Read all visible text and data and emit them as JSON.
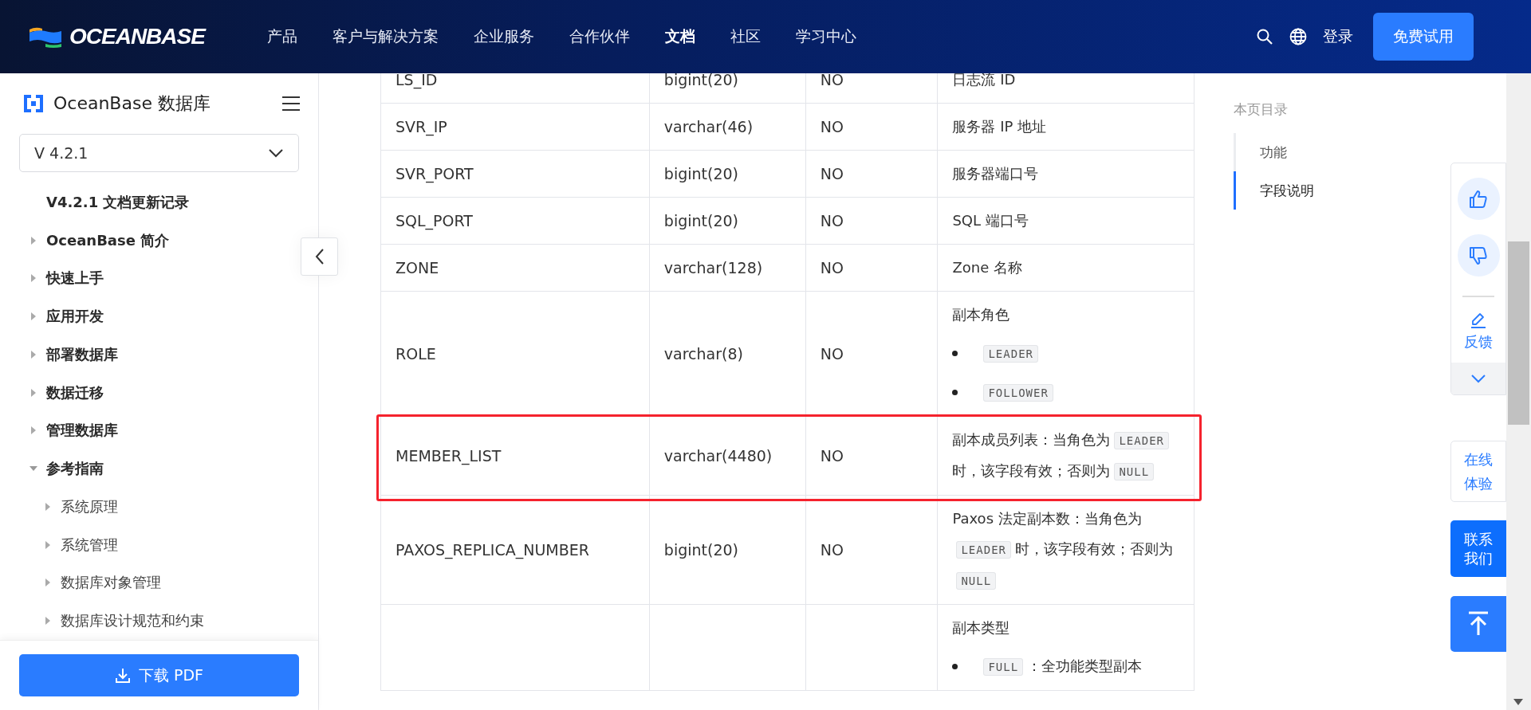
{
  "header": {
    "logo": "OCEANBASE",
    "nav": [
      {
        "label": "产品",
        "selected": false
      },
      {
        "label": "客户与解决方案",
        "selected": false
      },
      {
        "label": "企业服务",
        "selected": false
      },
      {
        "label": "合作伙伴",
        "selected": false
      },
      {
        "label": "文档",
        "selected": true
      },
      {
        "label": "社区",
        "selected": false
      },
      {
        "label": "学习中心",
        "selected": false
      }
    ],
    "login": "登录",
    "cta": "免费试用"
  },
  "sidebar": {
    "title": "OceanBase 数据库",
    "version": "V 4.2.1",
    "items": [
      {
        "label": "V4.2.1 文档更新记录"
      },
      {
        "label": "OceanBase 简介",
        "expanded": false
      },
      {
        "label": "快速上手",
        "expanded": false
      },
      {
        "label": "应用开发",
        "expanded": false
      },
      {
        "label": "部署数据库",
        "expanded": false
      },
      {
        "label": "数据迁移",
        "expanded": false
      },
      {
        "label": "管理数据库",
        "expanded": false
      },
      {
        "label": "参考指南",
        "expanded": true,
        "children": [
          {
            "label": "系统原理",
            "expanded": false
          },
          {
            "label": "系统管理",
            "expanded": false
          },
          {
            "label": "数据库对象管理",
            "expanded": false
          },
          {
            "label": "数据库设计规范和约束",
            "expanded": false
          }
        ]
      }
    ],
    "download": "下载 PDF"
  },
  "table": {
    "rows": [
      {
        "name": "LS_ID",
        "type": "bigint(20)",
        "nullable": "NO",
        "highlighted": false,
        "description": [
          {
            "kind": "para",
            "parts": [
              {
                "kind": "text",
                "text": "日志流 ID"
              }
            ]
          }
        ]
      },
      {
        "name": "SVR_IP",
        "type": "varchar(46)",
        "nullable": "NO",
        "highlighted": false,
        "description": [
          {
            "kind": "para",
            "parts": [
              {
                "kind": "text",
                "text": "服务器 IP 地址"
              }
            ]
          }
        ]
      },
      {
        "name": "SVR_PORT",
        "type": "bigint(20)",
        "nullable": "NO",
        "highlighted": false,
        "description": [
          {
            "kind": "para",
            "parts": [
              {
                "kind": "text",
                "text": "服务器端口号"
              }
            ]
          }
        ]
      },
      {
        "name": "SQL_PORT",
        "type": "bigint(20)",
        "nullable": "NO",
        "highlighted": false,
        "description": [
          {
            "kind": "para",
            "parts": [
              {
                "kind": "text",
                "text": "SQL 端口号"
              }
            ]
          }
        ]
      },
      {
        "name": "ZONE",
        "type": "varchar(128)",
        "nullable": "NO",
        "highlighted": false,
        "description": [
          {
            "kind": "para",
            "parts": [
              {
                "kind": "text",
                "text": "Zone 名称"
              }
            ]
          }
        ]
      },
      {
        "name": "ROLE",
        "type": "varchar(8)",
        "nullable": "NO",
        "highlighted": false,
        "description": [
          {
            "kind": "para",
            "parts": [
              {
                "kind": "text",
                "text": "副本角色"
              }
            ]
          },
          {
            "kind": "bullet",
            "parts": [
              {
                "kind": "code",
                "text": "LEADER"
              }
            ]
          },
          {
            "kind": "bullet",
            "parts": [
              {
                "kind": "code",
                "text": "FOLLOWER"
              }
            ]
          }
        ]
      },
      {
        "name": "MEMBER_LIST",
        "type": "varchar(4480)",
        "nullable": "NO",
        "highlighted": true,
        "description": [
          {
            "kind": "para",
            "parts": [
              {
                "kind": "text",
                "text": "副本成员列表：当角色为"
              },
              {
                "kind": "code",
                "text": "LEADER"
              },
              {
                "kind": "text",
                "text": "时，该字段有效；否则为"
              },
              {
                "kind": "code",
                "text": "NULL"
              }
            ]
          }
        ]
      },
      {
        "name": "PAXOS_REPLICA_NUMBER",
        "type": "bigint(20)",
        "nullable": "NO",
        "highlighted": false,
        "description": [
          {
            "kind": "para",
            "parts": [
              {
                "kind": "text",
                "text": "Paxos 法定副本数：当角色为"
              },
              {
                "kind": "code",
                "text": "LEADER"
              },
              {
                "kind": "text",
                "text": "时，该字段有效；否则为"
              },
              {
                "kind": "code",
                "text": "NULL"
              }
            ]
          }
        ]
      },
      {
        "highlighted": false,
        "description": [
          {
            "kind": "para",
            "parts": [
              {
                "kind": "text",
                "text": "副本类型"
              }
            ]
          },
          {
            "kind": "bullet",
            "parts": [
              {
                "kind": "code",
                "text": "FULL"
              },
              {
                "kind": "text",
                "text": "：全功能类型副本"
              }
            ]
          }
        ]
      }
    ]
  },
  "toc": {
    "title": "本页目录",
    "items": [
      {
        "label": "功能",
        "selected": false
      },
      {
        "label": "字段说明",
        "selected": true
      }
    ]
  },
  "float": {
    "feedback": "反馈",
    "try_online": "在线体验",
    "contact": "联系我们"
  }
}
